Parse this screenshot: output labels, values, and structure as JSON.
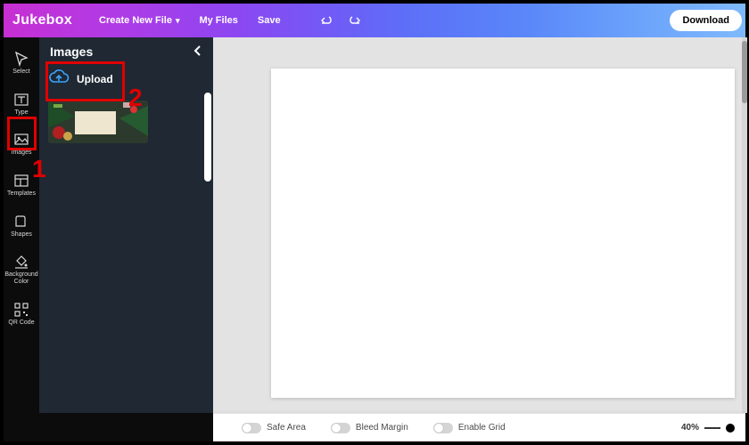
{
  "header": {
    "brand": "Jukebox",
    "create_label": "Create New File",
    "my_files_label": "My Files",
    "save_label": "Save",
    "download_label": "Download"
  },
  "tools": {
    "select": "Select",
    "type": "Type",
    "images": "Images",
    "templates": "Templates",
    "shapes": "Shapes",
    "bgcolor": "Background Color",
    "qrcode": "QR Code"
  },
  "panel": {
    "title": "Images",
    "upload_label": "Upload"
  },
  "bottom": {
    "safe_area": "Safe Area",
    "bleed_margin": "Bleed Margin",
    "enable_grid": "Enable Grid",
    "zoom": "40%"
  },
  "annotations": {
    "one": "1",
    "two": "2"
  }
}
